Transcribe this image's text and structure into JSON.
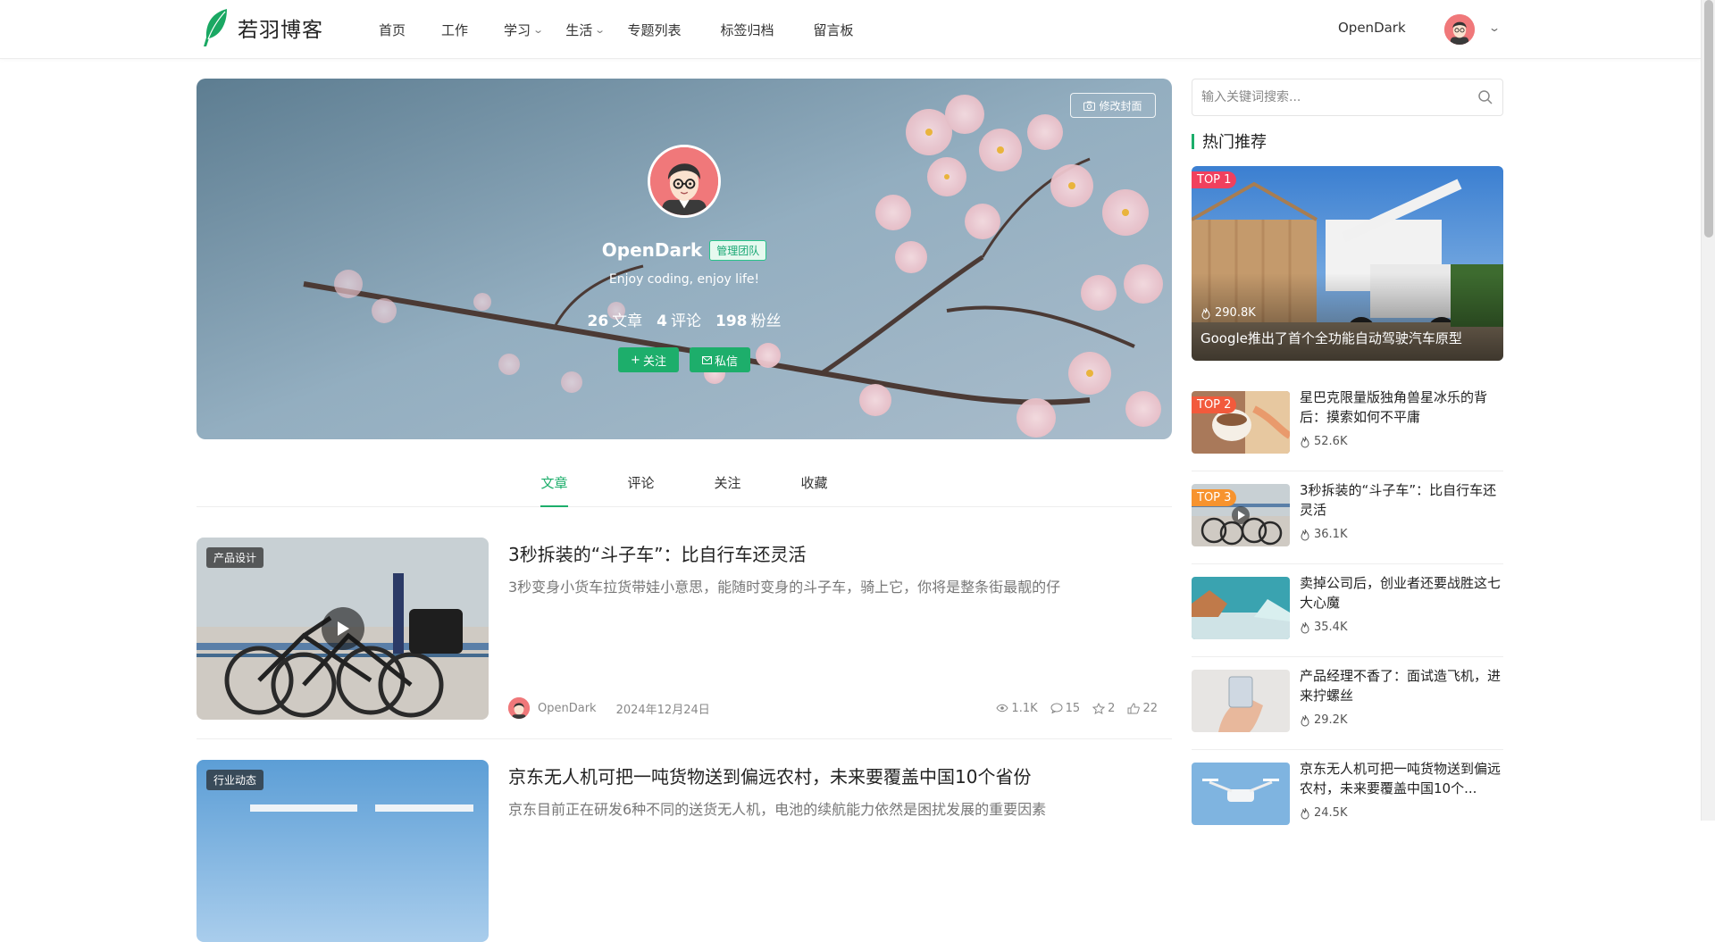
{
  "header": {
    "site_name": "若羽博客",
    "nav": [
      {
        "label": "首页",
        "has_dropdown": false
      },
      {
        "label": "工作",
        "has_dropdown": false
      },
      {
        "label": "学习",
        "has_dropdown": true
      },
      {
        "label": "生活",
        "has_dropdown": true
      },
      {
        "label": "专题列表",
        "has_dropdown": false
      },
      {
        "label": "标签归档",
        "has_dropdown": false
      },
      {
        "label": "留言板",
        "has_dropdown": false
      }
    ],
    "user_name": "OpenDark"
  },
  "profile": {
    "edit_cover_label": "修改封面",
    "name": "OpenDark",
    "badge": "管理团队",
    "bio": "Enjoy coding, enjoy life!",
    "stats": [
      {
        "value": "26",
        "label": "文章"
      },
      {
        "value": "4",
        "label": "评论"
      },
      {
        "value": "198",
        "label": "粉丝"
      }
    ],
    "follow_label": "关注",
    "message_label": "私信"
  },
  "tabs": [
    {
      "label": "文章",
      "active": true
    },
    {
      "label": "评论",
      "active": false
    },
    {
      "label": "关注",
      "active": false
    },
    {
      "label": "收藏",
      "active": false
    }
  ],
  "articles": [
    {
      "category": "产品设计",
      "has_video": true,
      "title": "3秒拆装的“斗子车”：比自行车还灵活",
      "desc": "3秒变身小货车拉货带娃小意思，能随时变身的斗子车，骑上它，你将是整条街最靓的仔",
      "author": "OpenDark",
      "date": "2024年12月24日",
      "views": "1.1K",
      "comments": "15",
      "favorites": "2",
      "likes": "22"
    },
    {
      "category": "行业动态",
      "has_video": false,
      "title": "京东无人机可把一吨货物送到偏远农村，未来要覆盖中国10个省份",
      "desc": "京东目前正在研发6种不同的送货无人机，电池的续航能力依然是困扰发展的重要因素"
    }
  ],
  "sidebar": {
    "search_placeholder": "输入关键词搜索...",
    "hot_title": "热门推荐",
    "hot_items": [
      {
        "rank": "TOP 1",
        "title": "Google推出了首个全功能自动驾驶汽车原型",
        "views": "290.8K"
      },
      {
        "rank": "TOP 2",
        "title": "星巴克限量版独角兽星冰乐的背后：摸索如何不平庸",
        "views": "52.6K"
      },
      {
        "rank": "TOP 3",
        "title": "3秒拆装的“斗子车”：比自行车还灵活",
        "views": "36.1K"
      },
      {
        "rank": "",
        "title": "卖掉公司后，创业者还要战胜这七大心魔",
        "views": "35.4K"
      },
      {
        "rank": "",
        "title": "产品经理不香了：面试造飞机，进来拧螺丝",
        "views": "29.2K"
      },
      {
        "rank": "",
        "title": "京东无人机可把一吨货物送到偏远农村，未来要覆盖中国10个...",
        "views": "24.5K"
      }
    ]
  },
  "colors": {
    "accent": "#1dae6b",
    "top1": "#f0405e",
    "top2": "#f25a3c",
    "top3": "#f7932e"
  }
}
